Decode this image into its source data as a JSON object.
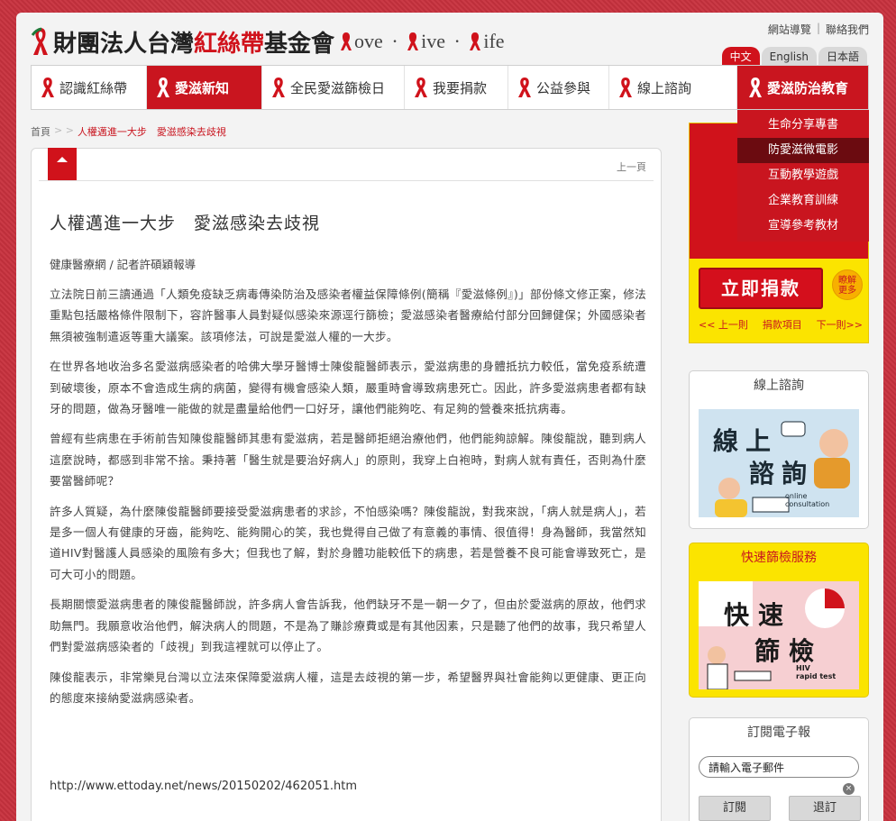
{
  "header": {
    "logo_prefix": "財團法人台灣",
    "logo_red": "紅絲帶",
    "logo_suffix": "基金會",
    "slogan": [
      "ove",
      "ive",
      "ife"
    ],
    "slogan_dot": "·",
    "links": [
      "網站導覽",
      "聯絡我們"
    ],
    "link_sep": "|",
    "languages": [
      "中文",
      "English",
      "日本語"
    ]
  },
  "nav": {
    "items": [
      "認識紅絲帶",
      "愛滋新知",
      "全民愛滋篩檢日",
      "我要捐款",
      "公益參與",
      "線上諮詢",
      "愛滋防治教育"
    ],
    "dropdown": [
      "生命分享專書",
      "防愛滋微電影",
      "互動教學遊戲",
      "企業教育訓練",
      "宣導參考教材"
    ]
  },
  "breadcrumb": {
    "home": "首頁",
    "sep": "> >",
    "current": "人權邁進一大步　愛滋感染去歧視"
  },
  "article": {
    "prev": "上一頁",
    "title": "人權邁進一大步　愛滋感染去歧視",
    "byline": "健康醫療網 / 記者許碩穎報導",
    "paragraphs": [
      "立法院日前三讀通過「人類免疫缺乏病毒傳染防治及感染者權益保障條例(簡稱『愛滋條例』)」部份條文修正案，修法重點包括嚴格條件限制下，容許醫事人員對疑似感染來源逕行篩檢；愛滋感染者醫療給付部分回歸健保；外國感染者無須被強制遣返等重大議案。該項修法，可說是愛滋人權的一大步。",
      "在世界各地收治多名愛滋病感染者的哈佛大學牙醫博士陳俊龍醫師表示，愛滋病患的身體抵抗力較低，當免疫系統遭到破壞後，原本不會造成生病的病菌，變得有機會感染人類，嚴重時會導致病患死亡。因此，許多愛滋病患者都有缺牙的問題，做為牙醫唯一能做的就是盡量給他們一口好牙，讓他們能夠吃、有足夠的營養來抵抗病毒。",
      "曾經有些病患在手術前告知陳俊龍醫師其患有愛滋病，若是醫師拒絕治療他們，他們能夠諒解。陳俊龍說，聽到病人這麼說時，都感到非常不捨。秉持著「醫生就是要治好病人」的原則，我穿上白袍時，對病人就有責任，否則為什麼要當醫師呢？",
      "許多人質疑，為什麼陳俊龍醫師要接受愛滋病患者的求診，不怕感染嗎？陳俊龍說，對我來說，「病人就是病人」，若是多一個人有健康的牙齒，能夠吃、能夠開心的笑，我也覺得自己做了有意義的事情、很值得！身為醫師，我當然知道HIV對醫護人員感染的風險有多大；但我也了解，對於身體功能較低下的病患，若是營養不良可能會導致死亡，是可大可小的問題。",
      "長期關懷愛滋病患者的陳俊龍醫師說，許多病人會告訴我，他們缺牙不是一朝一夕了，但由於愛滋病的原故，他們求助無門。我願意收治他們，解決病人的問題，不是為了賺診療費或是有其他因素，只是聽了他們的故事，我只希望人們對愛滋病感染者的「歧視」到我這裡就可以停止了。",
      "陳俊龍表示，非常樂見台灣以立法來保障愛滋病人權，這是去歧視的第一步，希望醫界與社會能夠以更健康、更正向的態度來接納愛滋病感染者。"
    ],
    "source": "http://www.ettoday.net/news/20150202/462051.htm"
  },
  "sidebar": {
    "donate_button": "立即捐款",
    "learn_more": [
      "瞭解",
      "更多"
    ],
    "donate_links": [
      "<< 上一則",
      "捐款項目",
      "下一則>>"
    ],
    "consult_title": "線上諮詢",
    "consult_img": {
      "line1": "線上",
      "line2": "諮詢",
      "line3a": "online",
      "line3b": "consultation"
    },
    "screening_title": "快速篩檢服務",
    "screening_img": {
      "line1": "快速",
      "line2": "篩檢",
      "line3a": "HIV",
      "line3b": "rapid test"
    },
    "newsletter_title": "訂閱電子報",
    "email_placeholder": "請輸入電子郵件",
    "subscribe": "訂閱",
    "unsubscribe": "退訂",
    "clear": "×"
  },
  "colors": {
    "brand_red": "#d0121b",
    "yellow": "#fbe400",
    "dark_red": "#6b0b10"
  }
}
